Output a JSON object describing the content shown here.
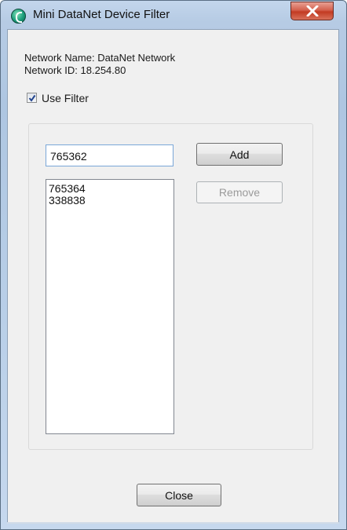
{
  "window": {
    "title": "Mini DataNet Device Filter",
    "app_icon": "datanet-app-icon",
    "close_icon": "close-x-icon"
  },
  "info": {
    "network_name_line": "Network Name: DataNet Network",
    "network_id_line": "Network ID: 18.254.80"
  },
  "filter": {
    "use_filter_label": "Use Filter",
    "use_filter_checked": true,
    "device_input_value": "765362",
    "add_label": "Add",
    "remove_label": "Remove",
    "remove_enabled": false,
    "devices": [
      "765364",
      "338838"
    ]
  },
  "footer": {
    "close_label": "Close"
  },
  "colors": {
    "title_bar": "#b9cfe8",
    "close_button": "#c23b22",
    "dialog_background": "#f0f0f0"
  }
}
